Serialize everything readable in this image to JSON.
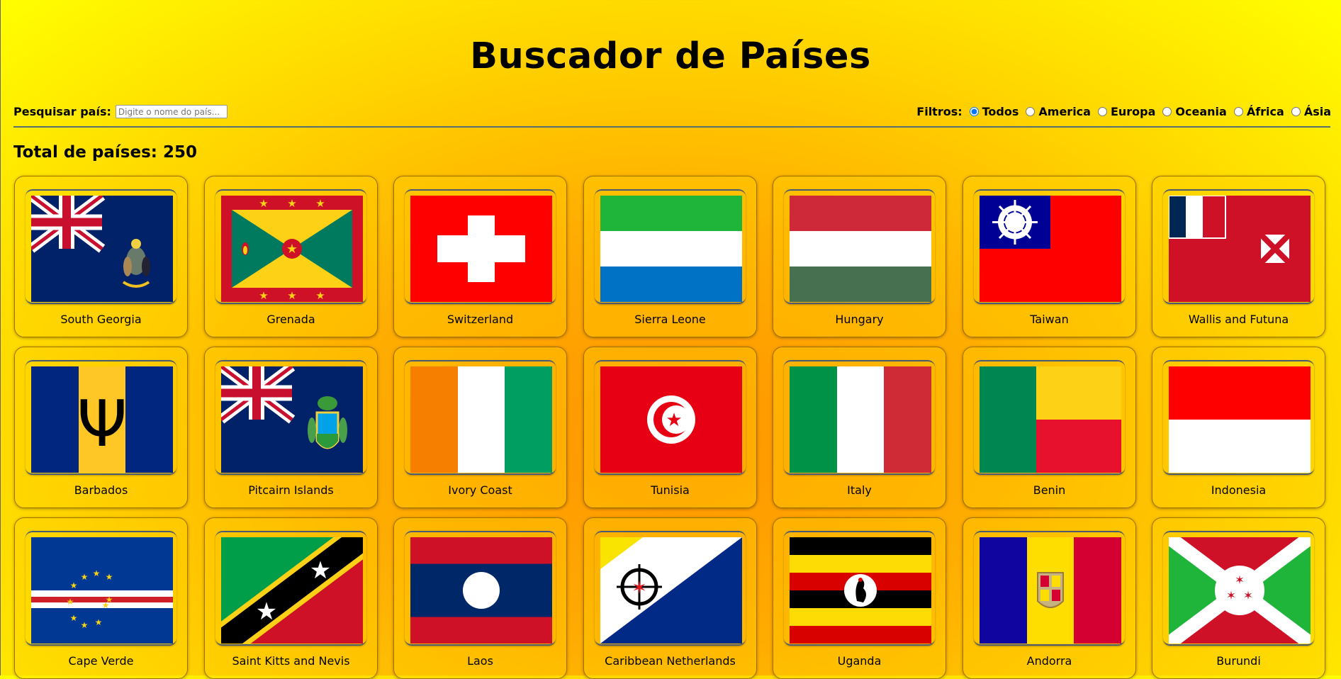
{
  "header": {
    "title": "Buscador de Países"
  },
  "search": {
    "label": "Pesquisar país:",
    "placeholder": "Digite o nome do país...",
    "value": ""
  },
  "filters": {
    "label": "Filtros:",
    "options": [
      "Todos",
      "America",
      "Europa",
      "Oceania",
      "África",
      "Ásia"
    ],
    "selected": "Todos"
  },
  "total": {
    "text": "Total de países: 250"
  },
  "countries": [
    {
      "name": "South Georgia",
      "flag": "south-georgia-flag"
    },
    {
      "name": "Grenada",
      "flag": "grenada-flag"
    },
    {
      "name": "Switzerland",
      "flag": "switzerland-flag"
    },
    {
      "name": "Sierra Leone",
      "flag": "sierra-leone-flag"
    },
    {
      "name": "Hungary",
      "flag": "hungary-flag"
    },
    {
      "name": "Taiwan",
      "flag": "taiwan-flag"
    },
    {
      "name": "Wallis and Futuna",
      "flag": "wallis-and-futuna-flag"
    },
    {
      "name": "Barbados",
      "flag": "barbados-flag"
    },
    {
      "name": "Pitcairn Islands",
      "flag": "pitcairn-islands-flag"
    },
    {
      "name": "Ivory Coast",
      "flag": "ivory-coast-flag"
    },
    {
      "name": "Tunisia",
      "flag": "tunisia-flag"
    },
    {
      "name": "Italy",
      "flag": "italy-flag"
    },
    {
      "name": "Benin",
      "flag": "benin-flag"
    },
    {
      "name": "Indonesia",
      "flag": "indonesia-flag"
    },
    {
      "name": "Cape Verde",
      "flag": "cape-verde-flag"
    },
    {
      "name": "Saint Kitts and Nevis",
      "flag": "saint-kitts-and-nevis-flag"
    },
    {
      "name": "Laos",
      "flag": "laos-flag"
    },
    {
      "name": "Caribbean Netherlands",
      "flag": "caribbean-netherlands-flag"
    },
    {
      "name": "Uganda",
      "flag": "uganda-flag"
    },
    {
      "name": "Andorra",
      "flag": "andorra-flag"
    },
    {
      "name": "Burundi",
      "flag": "burundi-flag"
    }
  ]
}
